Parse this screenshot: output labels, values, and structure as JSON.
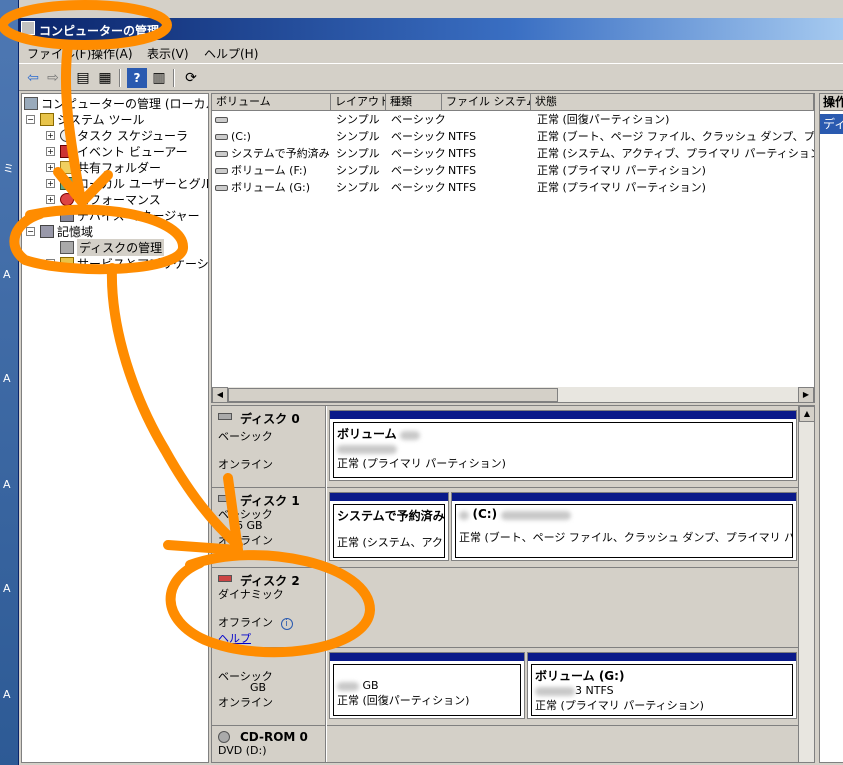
{
  "desktop": {
    "side_letters": [
      "ミ",
      "A",
      "A",
      "A",
      "A",
      "A"
    ]
  },
  "window": {
    "title": "コンピューターの管理"
  },
  "menu": [
    {
      "label": "ファイル(F)"
    },
    {
      "label": "操作(A)"
    },
    {
      "label": "表示(V)"
    },
    {
      "label": "ヘルプ(H)"
    }
  ],
  "toolbar": {
    "icons": [
      "back-arrow-icon",
      "forward-arrow-icon",
      "up-folder-icon",
      "show-hide-tree-icon",
      "help-icon",
      "properties-icon",
      "refresh-icon"
    ]
  },
  "tree": {
    "items": [
      {
        "label": "コンピューターの管理 (ローカル)",
        "icon": "computer-icon"
      },
      {
        "label": "システム ツール",
        "icon": "tools-icon"
      },
      {
        "label": "タスク スケジューラ",
        "icon": "clock-icon"
      },
      {
        "label": "イベント ビューアー",
        "icon": "event-viewer-icon"
      },
      {
        "label": "共有フォルダー",
        "icon": "folder-icon"
      },
      {
        "label": "ローカル ユーザーとグループ",
        "icon": "users-icon"
      },
      {
        "label": "パフォーマンス",
        "icon": "performance-icon"
      },
      {
        "label": "デバイス マネージャー",
        "icon": "device-icon"
      },
      {
        "label": "記憶域",
        "icon": "storage-icon"
      },
      {
        "label": "ディスクの管理",
        "icon": "disk-mgmt-icon"
      },
      {
        "label": "サービスとアプリケーション",
        "icon": "services-icon"
      }
    ]
  },
  "volumes": {
    "columns": [
      "ボリューム",
      "レイアウト",
      "種類",
      "ファイル システム",
      "状態"
    ],
    "rows": [
      {
        "volume": "",
        "layout": "シンプル",
        "type": "ベーシック",
        "fs": "",
        "status": "正常 (回復パーティション)"
      },
      {
        "volume": "(C:)",
        "layout": "シンプル",
        "type": "ベーシック",
        "fs": "NTFS",
        "status": "正常 (ブート、ページ ファイル、クラッシュ ダンプ、プライマリ パ"
      },
      {
        "volume": "システムで予約済み",
        "layout": "シンプル",
        "type": "ベーシック",
        "fs": "NTFS",
        "status": "正常 (システム、アクティブ、プライマリ パーティション)"
      },
      {
        "volume": "ボリューム (F:)",
        "layout": "シンプル",
        "type": "ベーシック",
        "fs": "NTFS",
        "status": "正常 (プライマリ パーティション)"
      },
      {
        "volume": "ボリューム (G:)",
        "layout": "シンプル",
        "type": "ベーシック",
        "fs": "NTFS",
        "status": "正常 (プライマリ パーティション)"
      }
    ]
  },
  "disks": {
    "disk0": {
      "name": "ディスク 0",
      "kind": "ベーシック",
      "state": "オンライン",
      "partition": {
        "name": "ボリューム",
        "status": "正常 (プライマリ パーティション)"
      }
    },
    "disk1": {
      "name": "ディスク 1",
      "kind": "ベーシック",
      "size": "6 GB",
      "state": "オンライン",
      "partitions": [
        {
          "name": "システムで予約済み",
          "status": "正常 (システム、アクティブ"
        },
        {
          "name": "(C:)",
          "status": "正常 (ブート、ページ ファイル、クラッシュ ダンプ、プライマリ パーティション)"
        }
      ]
    },
    "disk2": {
      "name": "ディスク 2",
      "kind": "ダイナミック",
      "state": "オフライン",
      "help": "ヘルプ"
    },
    "disk3": {
      "kind": "ベーシック",
      "size": "GB",
      "state": "オンライン",
      "partitions": [
        {
          "size": "GB",
          "status": "正常 (回復パーティション)"
        },
        {
          "name": "ボリューム (G:)",
          "fs": "3 NTFS",
          "status": "正常 (プライマリ パーティション)"
        }
      ]
    },
    "cdrom": {
      "name": "CD-ROM 0",
      "drive": "DVD (D:)"
    }
  },
  "actions": {
    "header": "操作",
    "item": "ディ"
  },
  "annotation": {
    "color": "#ff8c00"
  }
}
